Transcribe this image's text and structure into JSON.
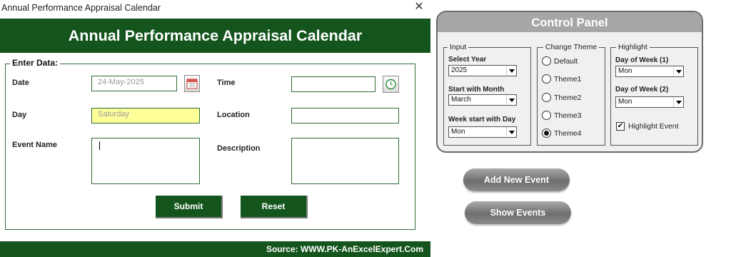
{
  "window": {
    "title": "Annual Performance Appraisal Calendar",
    "close_glyph": "✕"
  },
  "header": {
    "title": "Annual Performance Appraisal Calendar"
  },
  "form": {
    "legend": "Enter Data:",
    "date": {
      "label": "Date",
      "value": "24-May-2025"
    },
    "time": {
      "label": "Time",
      "value": ""
    },
    "day": {
      "label": "Day",
      "value": "Saturday"
    },
    "location": {
      "label": "Location",
      "value": ""
    },
    "event_name": {
      "label": "Event Name",
      "value": ""
    },
    "description": {
      "label": "Description",
      "value": ""
    },
    "submit_label": "Submit",
    "reset_label": "Reset"
  },
  "footer": {
    "text": "Source: WWW.PK-AnExcelExpert.Com"
  },
  "control_panel": {
    "title": "Control Panel",
    "input": {
      "legend": "Input",
      "select_year": {
        "label": "Select Year",
        "value": "2025"
      },
      "start_month": {
        "label": "Start with Month",
        "value": "March"
      },
      "week_start": {
        "label": "Week start with Day",
        "value": "Mon"
      }
    },
    "theme": {
      "legend": "Change Theme",
      "options": [
        "Default",
        "Theme1",
        "Theme2",
        "Theme3",
        "Theme4"
      ],
      "selected": "Theme4"
    },
    "highlight": {
      "legend": "Highlight",
      "dow1": {
        "label": "Day of Week (1)",
        "value": "Mon"
      },
      "dow2": {
        "label": "Day of Week (2)",
        "value": "Mon"
      },
      "highlight_event": {
        "label": "Highlight Event",
        "checked": true
      }
    }
  },
  "actions": {
    "add_event_label": "Add New Event",
    "show_events_label": "Show Events"
  },
  "colors": {
    "brand_green": "#14551d",
    "field_yellow": "#ffff99",
    "panel_grey": "#a6a6a6"
  }
}
